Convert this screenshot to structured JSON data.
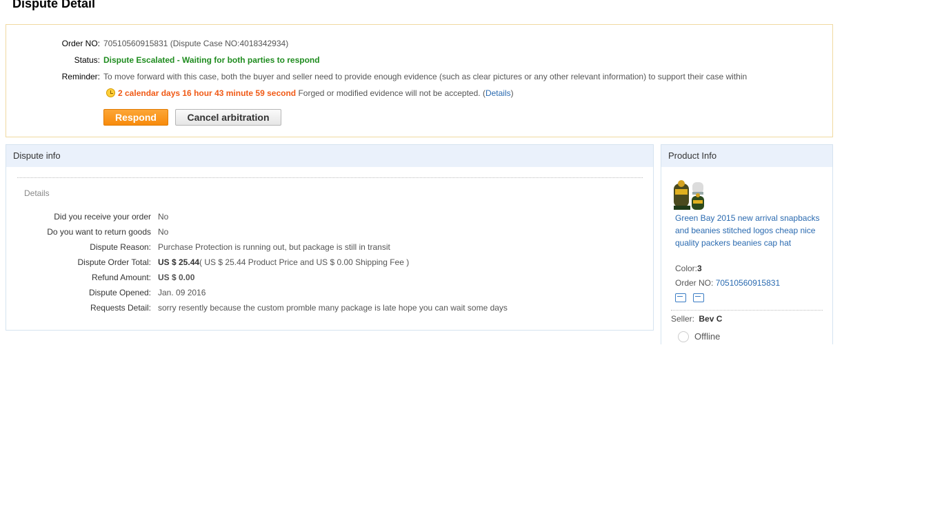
{
  "page_title": "Dispute Detail",
  "summary": {
    "order_label": "Order NO:",
    "order_value": "70510560915831 (Dispute Case NO:4018342934)",
    "status_label": "Status:",
    "status_value": "Dispute Escalated - Waiting for both parties to respond",
    "reminder_label": "Reminder:",
    "reminder_text": "To move forward with this case, both the buyer and seller need to provide enough evidence (such as clear pictures or any other relevant information) to support their case within",
    "countdown": "2 calendar days 16 hour 43 minute 59 second",
    "forged_text": "Forged or modified evidence will not be accepted. (",
    "details_link": "Details",
    "close_paren": ")",
    "respond_label": "Respond",
    "cancel_label": "Cancel arbitration"
  },
  "dispute_info": {
    "heading": "Dispute info",
    "details_title": "Details",
    "rows": [
      {
        "label": "Did you receive your order",
        "value": "No"
      },
      {
        "label": "Do you want to return goods",
        "value": "No"
      },
      {
        "label": "Dispute Reason:",
        "value": "Purchase Protection is running out, but package is still in transit"
      },
      {
        "label": "Dispute Order Total:",
        "value_bold": "US $ 25.44",
        "value": "( US $ 25.44 Product Price and US $ 0.00 Shipping Fee )"
      },
      {
        "label": "Refund Amount:",
        "value": "US $ 0.00"
      },
      {
        "label": "Dispute Opened:",
        "value": "Jan. 09 2016"
      },
      {
        "label": "Requests Detail:",
        "value": "sorry resently because the custom promble many package is late hope you can wait some days"
      }
    ]
  },
  "product_info": {
    "heading": "Product Info",
    "name": "Green Bay 2015 new arrival snapbacks and beanies stitched logos cheap nice quality packers beanies cap hat",
    "color_label": "Color:",
    "color_value": "3",
    "order_label": "Order NO: ",
    "order_value": "70510560915831",
    "seller_label": "Seller:",
    "seller_value": "Bev C",
    "status": "Offline"
  },
  "colors": {
    "accent_orange": "#f05a16",
    "status_green": "#1f8c1f",
    "link_blue": "#2a6ab0",
    "button_orange": "#f88b0c"
  }
}
